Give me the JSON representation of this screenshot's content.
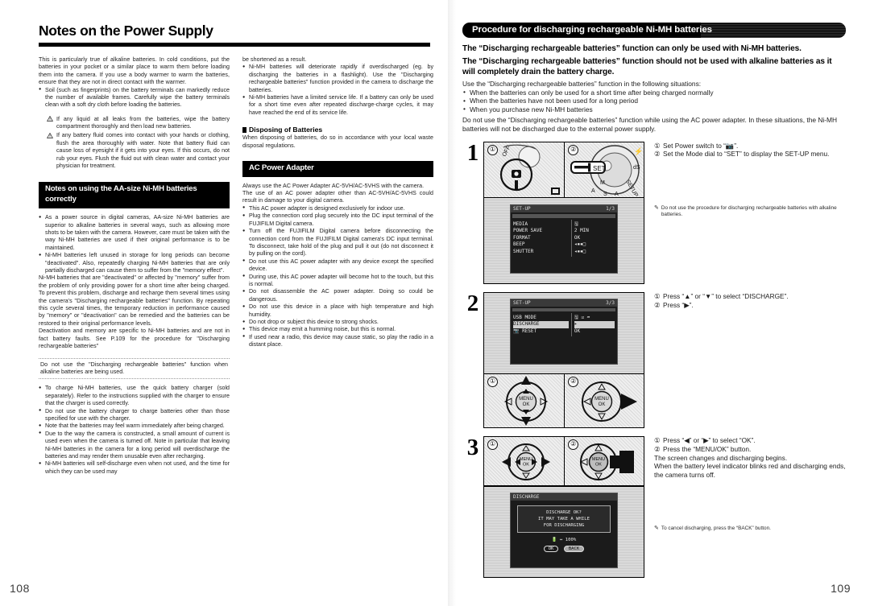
{
  "left_page": {
    "chapter_title": "Notes on the Power Supply",
    "folio": "108",
    "col1": {
      "intro": "This is particularly true of alkaline batteries. In cold conditions, put the batteries in your pocket or a similar place to warm them before loading them into the camera. If you use a body warmer to warm the batteries, ensure that they are not in direct contact with the warmer.",
      "bullet_soil": "Soil (such as fingerprints) on the battery terminals can markedly reduce the number of available frames. Carefully wipe the battery terminals clean with a soft dry cloth before loading the batteries.",
      "caution_1": "If any liquid at all leaks from the batteries, wipe the battery compartment thoroughly and then load new batteries.",
      "caution_2": "If any battery fluid comes into contact with your hands or clothing, flush the area thoroughly with water. Note that battery fluid can cause loss of eyesight if it gets into your eyes. If this occurs, do not rub your eyes. Flush the fluid out with clean water and contact your physician for treatment.",
      "banner": "Notes on using the AA-size Ni-MH batteries correctly",
      "b1": "As a power source in digital cameras, AA-size Ni-MH batteries are superior to alkaline batteries in several ways, such as allowing more shots to be taken with the camera. However, care must be taken with the way Ni-MH batteries are used if their original performance is to be maintained.",
      "b2": "Ni-MH batteries left unused in storage for long periods can become \"deactivated\". Also, repeatedly charging Ni-MH batteries that are only partially discharged can cause them to suffer from the \"memory effect\".",
      "b2_cont1": "Ni-MH batteries that are \"deactivated\" or affected by \"memory\" suffer from the problem of only providing power for a short time after being charged. To prevent this problem, discharge and recharge them several times using the camera's \"Discharging rechargeable batteries\" function. By repeating this cycle several times, the temporary reduction in performance caused by \"memory\" or \"deactivation\" can be remedied and the batteries can be restored to their original performance levels.",
      "b2_cont2": "Deactivation and memory are specific to Ni-MH batteries and are not in fact battery faults. See P.109 for the procedure for \"Discharging rechargeable batteries\"",
      "notice": "Do not use the \"Discharging rechargeable batteries\" function when alkaline batteries are being used.",
      "b3": "To charge Ni-MH batteries, use the quick battery charger (sold separately). Refer to the instructions supplied with the charger to ensure that the charger is used correctly.",
      "b4": "Do not use the battery charger to charge batteries other than those specified for use with the charger.",
      "b5": "Note that the batteries may feel warm immediately after being charged.",
      "b6": "Due to the way the camera is constructed, a small amount of current is used even when the camera is turned off. Note in particular that leaving Ni-MH batteries in the camera for a long period will overdischarge the batteries and may render them unusable even after recharging.",
      "b7": "Ni-MH batteries will self-discharge even when not used, and the time for which they can be used may"
    },
    "col2": {
      "cont_top": "be shortened as a result.",
      "b1": "Ni-MH batteries will deteriorate rapidly if overdischarged (eg. by discharging the batteries in a flashlight). Use the \"Discharging rechargeable batteries\" function provided in the camera to discharge the batteries.",
      "b2": "Ni-MH batteries have a limited service life. If a battery can only be used for a short time even after repeated discharge-charge cycles, it may have reached the end of its service life.",
      "subhead_disposing": "Disposing of Batteries",
      "disposing_text": "When disposing of batteries, do so in accordance with your local waste disposal regulations.",
      "banner_ac": "AC Power Adapter",
      "ac_intro1": "Always use the AC Power Adapter AC-5VH/AC-5VHS with the camera.",
      "ac_intro2": "The use of an AC power adapter other than AC-5VH/AC-5VHS could result in damage to your digital camera.",
      "ac1": "This AC power adapter is designed exclusively for indoor use.",
      "ac2": "Plug the connection cord plug securely into the DC input terminal of the FUJIFILM Digital camera.",
      "ac3": "Turn off the FUJIFILM Digital camera before disconnecting the connection cord from the FUJIFILM Digital camera's DC input terminal. To disconnect, take hold of the plug and pull it out (do not disconnect it by pulling on the cord).",
      "ac4": "Do not use this AC power adapter with any device except the specified device.",
      "ac5": "During use, this AC power adapter will become hot to the touch, but this is normal.",
      "ac6": "Do not disassemble the AC power adapter. Doing so could be dangerous.",
      "ac7": "Do not use this device in a place with high temperature and high humidity.",
      "ac8": "Do not drop or subject this device to strong shocks.",
      "ac9": "This device may emit a humming noise, but this is normal.",
      "ac10": "If used near a radio, this device may cause static, so play the radio in a distant place."
    }
  },
  "right_page": {
    "folio": "109",
    "banner": "Procedure for discharging rechargeable Ni-MH batteries",
    "lead1": "The “Discharging rechargeable batteries” function can only be used with Ni-MH batteries.",
    "lead2": "The “Discharging rechargeable batteries” function should not be used with alkaline batteries as it will completely drain the battery charge.",
    "use_when_intro": "Use the “Discharging rechargeable batteries” function in the following situations:",
    "use_when": [
      "When the batteries can only be used for a short time after being charged normally",
      "When the batteries have not been used for a long period",
      "When you purchase new Ni-MH batteries"
    ],
    "warning_para": "Do not use the “Discharging rechargeable batteries” function while using the AC power adapter. In these situations, the Ni-MH batteries will not be discharged due to the external power supply.",
    "steps": [
      {
        "num": "1",
        "lines": [
          {
            "marker": "①",
            "text": "Set Power switch to “📷”."
          },
          {
            "marker": "②",
            "text": "Set the Mode dial to “SET” to display the SET-UP menu."
          }
        ],
        "fig_labels": {
          "left": "①",
          "right": "②"
        },
        "dial_text": "SET",
        "power_off_label": "OFF",
        "dial_marks": [
          "M",
          "A",
          "S",
          "A"
        ],
        "note": "Do not use the procedure for discharging rechargeable batteries with alkaline batteries.",
        "lcd": {
          "title": "SET-UP",
          "page": "1/3",
          "tab_left": "SET-UP 1",
          "tab_right": "OK",
          "rows": [
            {
              "label": "MEDIA",
              "value": "🖫"
            },
            {
              "label": "POWER SAVE",
              "value": "2 MIN"
            },
            {
              "label": "FORMAT",
              "value": "OK"
            },
            {
              "label": "BEEP",
              "value": "◂▪▪□"
            },
            {
              "label": "SHUTTER",
              "value": "◂▪▪□"
            }
          ]
        }
      },
      {
        "num": "2",
        "lines": [
          {
            "marker": "①",
            "text": "Press “▲” or “▼” to select “DISCHARGE”."
          },
          {
            "marker": "②",
            "text": "Press “▶”."
          }
        ],
        "fig_labels": {
          "left": "①",
          "right": "②"
        },
        "pad_center_label": "MENU\nOK",
        "lcd": {
          "title": "SET-UP",
          "page": "3/3",
          "rows": [
            {
              "label": "USB MODE",
              "value": "🖫 ☑ ➦"
            },
            {
              "label": "DISCHARGE",
              "value": "▸",
              "selected": true
            },
            {
              "label": "📷 RESET",
              "value": "OK"
            }
          ]
        }
      },
      {
        "num": "3",
        "lines": [
          {
            "marker": "①",
            "text": "Press “◀” or “▶” to select “OK”."
          },
          {
            "marker": "②",
            "text": "Press the “MENU/OK” button."
          },
          {
            "marker": "",
            "text": "The screen changes and discharging begins."
          },
          {
            "marker": "",
            "text": "When the battery level indicator blinks red and discharging ends, the camera turns off."
          }
        ],
        "fig_labels": {
          "left": "①",
          "right": "②"
        },
        "note": "To cancel discharging, press the “BACK” button.",
        "lcd": {
          "title": "DISCHARGE",
          "message_lines": [
            "DISCHARGE OK?",
            "IT MAY TAKE A WHILE",
            "FOR DISCHARGING"
          ],
          "battery_line": "🔋 ↔ 100%",
          "ok_label": "OK",
          "back_label": "BACK"
        }
      }
    ]
  }
}
